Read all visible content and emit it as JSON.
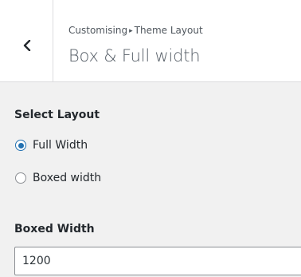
{
  "header": {
    "breadcrumb_parent": "Customising",
    "breadcrumb_separator": "▸",
    "breadcrumb_current": "Theme Layout",
    "title": "Box & Full width",
    "back_icon": "chevron-left-icon"
  },
  "select_layout": {
    "label": "Select Layout",
    "options": [
      {
        "label": "Full Width",
        "selected": true
      },
      {
        "label": "Boxed width",
        "selected": false
      }
    ]
  },
  "boxed_width": {
    "label": "Boxed Width",
    "value": "1200"
  },
  "colors": {
    "accent": "#2271b1",
    "panel_background": "#f1f1f1",
    "header_background": "#ffffff"
  }
}
